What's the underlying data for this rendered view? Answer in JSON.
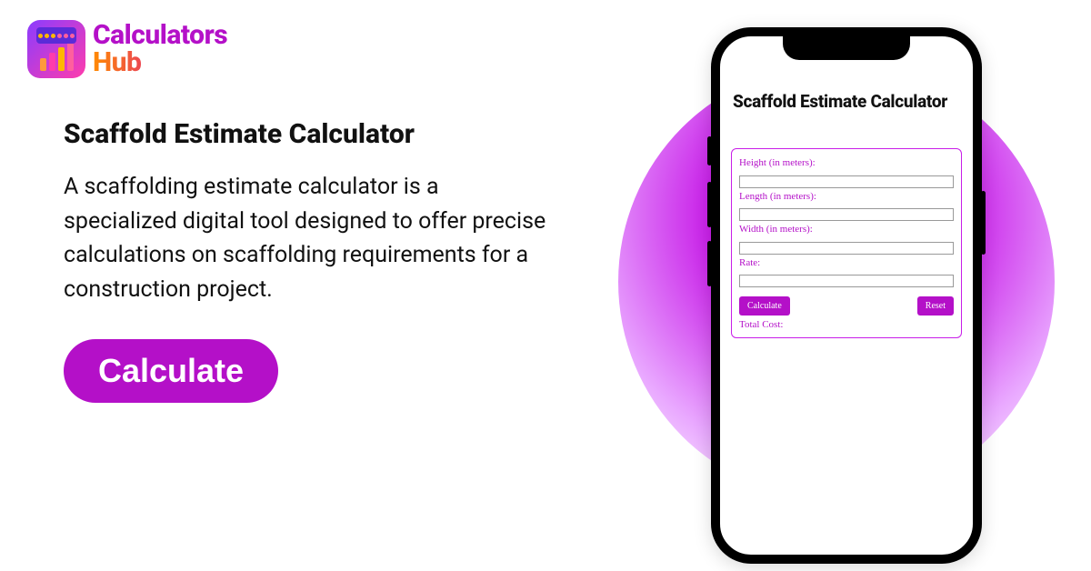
{
  "logo": {
    "line1": "Calculators",
    "line2": "Hub"
  },
  "page": {
    "heading": "Scaffold Estimate Calculator",
    "description": "A scaffolding estimate calculator is a specialized digital tool designed to offer precise calculations on scaffolding requirements for a construction project.",
    "cta": "Calculate"
  },
  "phone": {
    "title": "Scaffold Estimate Calculator",
    "fields": {
      "height_label": "Height (in meters):",
      "length_label": "Length (in meters):",
      "width_label": "Width (in meters):",
      "rate_label": "Rate:"
    },
    "buttons": {
      "calculate": "Calculate",
      "reset": "Reset"
    },
    "result_label": "Total Cost:"
  },
  "colors": {
    "accent": "#b410c8"
  }
}
